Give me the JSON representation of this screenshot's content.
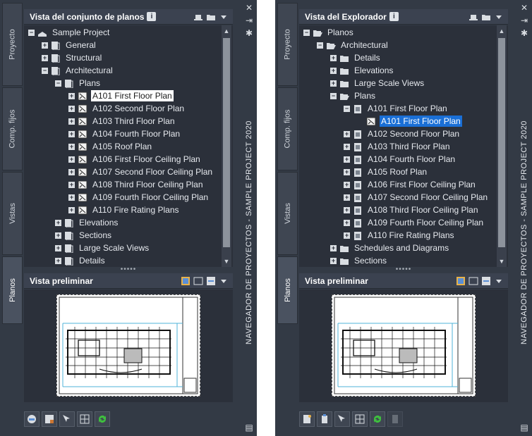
{
  "left_palette": {
    "side_tabs": [
      "Proyecto",
      "Comp. fijos",
      "Vistas",
      "Planos"
    ],
    "header_title": "Vista del conjunto de planos",
    "tree": [
      {
        "label": "Sample Project",
        "exp": "−",
        "icon": "project-icon",
        "sel": ""
      },
      {
        "label": "General",
        "exp": "+",
        "icon": "subset-icon",
        "sel": ""
      },
      {
        "label": "Structural",
        "exp": "+",
        "icon": "subset-icon",
        "sel": ""
      },
      {
        "label": "Architectural",
        "exp": "−",
        "icon": "subset-icon",
        "sel": ""
      },
      {
        "label": "Plans",
        "exp": "−",
        "icon": "subset-icon",
        "sel": ""
      },
      {
        "label": "A101 First Floor Plan",
        "exp": "+",
        "icon": "sheet-icon",
        "sel": "white"
      },
      {
        "label": "A102 Second Floor Plan",
        "exp": "+",
        "icon": "sheet-icon",
        "sel": ""
      },
      {
        "label": "A103 Third Floor Plan",
        "exp": "+",
        "icon": "sheet-icon",
        "sel": ""
      },
      {
        "label": "A104 Fourth Floor Plan",
        "exp": "+",
        "icon": "sheet-icon",
        "sel": ""
      },
      {
        "label": "A105 Roof Plan",
        "exp": "+",
        "icon": "sheet-icon",
        "sel": ""
      },
      {
        "label": "A106 First Floor Ceiling Plan",
        "exp": "+",
        "icon": "sheet-icon",
        "sel": ""
      },
      {
        "label": "A107 Second Floor Ceiling Plan",
        "exp": "+",
        "icon": "sheet-icon",
        "sel": ""
      },
      {
        "label": "A108 Third Floor Ceiling Plan",
        "exp": "+",
        "icon": "sheet-icon",
        "sel": ""
      },
      {
        "label": "A109 Fourth Floor Ceiling Plan",
        "exp": "+",
        "icon": "sheet-icon",
        "sel": ""
      },
      {
        "label": "A110 Fire Rating Plans",
        "exp": "+",
        "icon": "sheet-icon",
        "sel": ""
      },
      {
        "label": "Elevations",
        "exp": "+",
        "icon": "subset-icon",
        "sel": ""
      },
      {
        "label": "Sections",
        "exp": "+",
        "icon": "subset-icon",
        "sel": ""
      },
      {
        "label": "Large Scale Views",
        "exp": "+",
        "icon": "subset-icon",
        "sel": ""
      },
      {
        "label": "Details",
        "exp": "+",
        "icon": "subset-icon",
        "sel": ""
      }
    ],
    "preview_title": "Vista preliminar",
    "bottom_buttons": [
      "eplot-icon",
      "sheet-setup-icon",
      "select-view-icon",
      "layout-icon",
      "refresh-icon"
    ]
  },
  "right_palette": {
    "side_tabs": [
      "Proyecto",
      "Comp. fijos",
      "Vistas",
      "Planos"
    ],
    "header_title": "Vista del Explorador",
    "tree": [
      {
        "label": "Planos",
        "exp": "−",
        "icon": "folder-open-icon",
        "sel": ""
      },
      {
        "label": "Architectural",
        "exp": "−",
        "icon": "folder-open-icon",
        "sel": ""
      },
      {
        "label": "Details",
        "exp": "+",
        "icon": "folder-icon",
        "sel": ""
      },
      {
        "label": "Elevations",
        "exp": "+",
        "icon": "folder-icon",
        "sel": ""
      },
      {
        "label": "Large Scale Views",
        "exp": "+",
        "icon": "folder-icon",
        "sel": ""
      },
      {
        "label": "Plans",
        "exp": "−",
        "icon": "folder-open-icon",
        "sel": ""
      },
      {
        "label": "A101 First Floor Plan",
        "exp": "−",
        "icon": "drawing-file-icon",
        "sel": ""
      },
      {
        "label": "A101 First Floor Plan",
        "exp": "",
        "icon": "sheet-icon",
        "sel": "blue"
      },
      {
        "label": "A102 Second Floor Plan",
        "exp": "+",
        "icon": "drawing-file-icon",
        "sel": ""
      },
      {
        "label": "A103 Third Floor Plan",
        "exp": "+",
        "icon": "drawing-file-icon",
        "sel": ""
      },
      {
        "label": "A104 Fourth Floor Plan",
        "exp": "+",
        "icon": "drawing-file-icon",
        "sel": ""
      },
      {
        "label": "A105 Roof Plan",
        "exp": "+",
        "icon": "drawing-file-icon",
        "sel": ""
      },
      {
        "label": "A106 First Floor Ceiling Plan",
        "exp": "+",
        "icon": "drawing-file-icon",
        "sel": ""
      },
      {
        "label": "A107 Second Floor Ceiling Plan",
        "exp": "+",
        "icon": "drawing-file-icon",
        "sel": ""
      },
      {
        "label": "A108 Third Floor Ceiling Plan",
        "exp": "+",
        "icon": "drawing-file-icon",
        "sel": ""
      },
      {
        "label": "A109 Fourth Floor Ceiling Plan",
        "exp": "+",
        "icon": "drawing-file-icon",
        "sel": ""
      },
      {
        "label": "A110 Fire Rating Plans",
        "exp": "+",
        "icon": "drawing-file-icon",
        "sel": ""
      },
      {
        "label": "Schedules and Diagrams",
        "exp": "+",
        "icon": "folder-icon",
        "sel": ""
      },
      {
        "label": "Sections",
        "exp": "+",
        "icon": "folder-icon",
        "sel": ""
      }
    ],
    "preview_title": "Vista preliminar",
    "bottom_buttons": [
      "new-sheet-icon",
      "open-file-icon",
      "select-view-icon",
      "layout-icon",
      "refresh-icon",
      "disabled-tool-icon"
    ]
  },
  "palette_title": "NAVEGADOR DE PROYECTOS - SAMPLE PROJECT 2020",
  "colors": {
    "panel_bg": "#333a45",
    "tree_bg": "#2b303a",
    "selection_blue": "#1a6fd6",
    "selection_white": "#ffffff"
  }
}
